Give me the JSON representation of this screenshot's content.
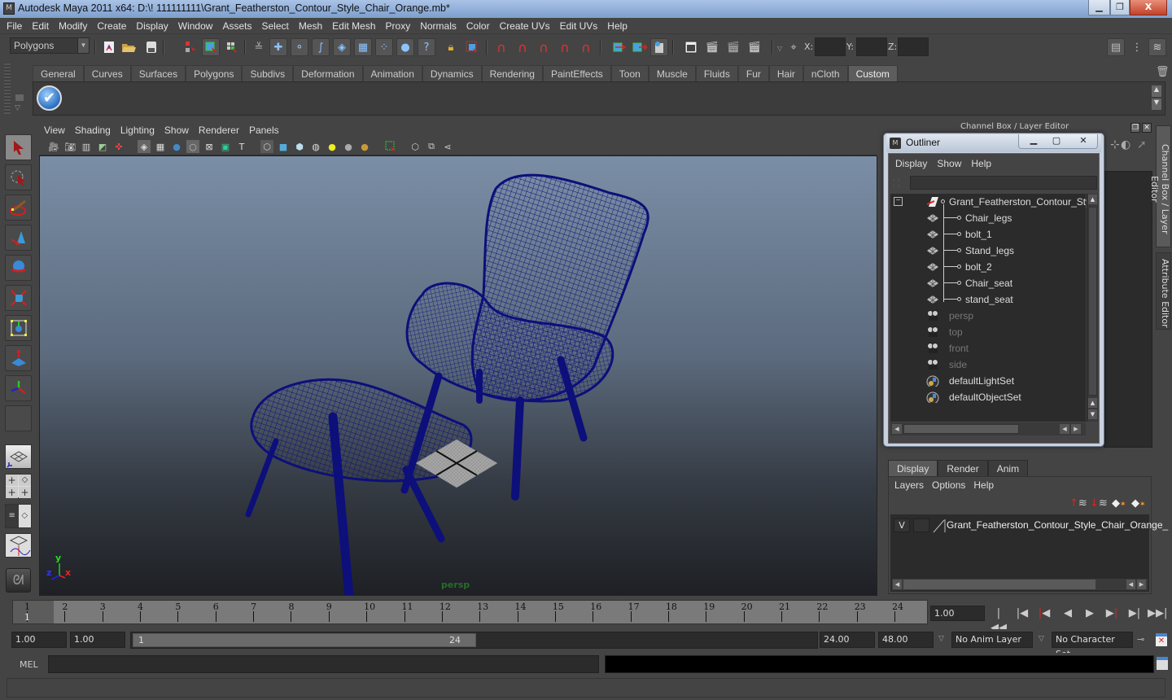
{
  "window": {
    "title": "Autodesk Maya 2011 x64: D:\\! 111111111\\Grant_Featherston_Contour_Style_Chair_Orange.mb*",
    "controls": {
      "minimize": "▁",
      "restore": "❐",
      "close": "X"
    }
  },
  "menubar": [
    "File",
    "Edit",
    "Modify",
    "Create",
    "Display",
    "Window",
    "Assets",
    "Select",
    "Mesh",
    "Edit Mesh",
    "Proxy",
    "Normals",
    "Color",
    "Create UVs",
    "Edit UVs",
    "Help"
  ],
  "statusline": {
    "mode_selector": "Polygons",
    "xyz_labels": {
      "x": "X:",
      "y": "Y:",
      "z": "Z:"
    },
    "icons": [
      "new-scene-icon",
      "open-scene-icon",
      "save-scene-icon",
      "select-by-hierarchy-icon",
      "select-by-object-icon",
      "select-by-component-icon",
      "snap-grid-icon",
      "snap-curve-icon",
      "snap-point-icon",
      "snap-view-plane-icon",
      "snap-live-icon",
      "render-icon",
      "ipr-render-icon",
      "render-settings-icon",
      "hypershade-icon"
    ]
  },
  "shelf": {
    "tabs": [
      "General",
      "Curves",
      "Surfaces",
      "Polygons",
      "Subdivs",
      "Deformation",
      "Animation",
      "Dynamics",
      "Rendering",
      "PaintEffects",
      "Toon",
      "Muscle",
      "Fluids",
      "Fur",
      "Hair",
      "nCloth",
      "Custom"
    ],
    "active_tab": "Custom"
  },
  "toolbox": {
    "tools": [
      "select-tool",
      "lasso-tool",
      "paint-select-tool",
      "move-tool",
      "rotate-tool",
      "scale-tool",
      "universal-manipulator",
      "soft-modification-tool",
      "show-manipulator-tool",
      "last-tool-slot"
    ],
    "layouts": [
      "single-perspective-layout",
      "four-view-layout",
      "outliner-persp-layout",
      "graph-editor-layout"
    ]
  },
  "viewport": {
    "panel_menu": [
      "View",
      "Shading",
      "Lighting",
      "Show",
      "Renderer",
      "Panels"
    ],
    "camera_label": "persp",
    "axis": {
      "x": "x",
      "y": "y",
      "z": "z"
    },
    "wire_color": "#0d0f7a"
  },
  "channel_box": {
    "title": "Channel Box / Layer Editor",
    "side_tabs": [
      "Channel Box / Layer Editor",
      "Attribute Editor"
    ]
  },
  "outliner": {
    "title": "Outliner",
    "menu": [
      "Display",
      "Show",
      "Help"
    ],
    "items": [
      {
        "label": "Grant_Featherston_Contour_Style",
        "type": "group",
        "dim": false
      },
      {
        "label": "Chair_legs",
        "type": "mesh",
        "dim": false
      },
      {
        "label": "bolt_1",
        "type": "mesh",
        "dim": false
      },
      {
        "label": "Stand_legs",
        "type": "mesh",
        "dim": false
      },
      {
        "label": "bolt_2",
        "type": "mesh",
        "dim": false
      },
      {
        "label": "Chair_seat",
        "type": "mesh",
        "dim": false
      },
      {
        "label": "stand_seat",
        "type": "mesh",
        "dim": false
      },
      {
        "label": "persp",
        "type": "camera",
        "dim": true
      },
      {
        "label": "top",
        "type": "camera",
        "dim": true
      },
      {
        "label": "front",
        "type": "camera",
        "dim": true
      },
      {
        "label": "side",
        "type": "camera",
        "dim": true
      },
      {
        "label": "defaultLightSet",
        "type": "set",
        "dim": false
      },
      {
        "label": "defaultObjectSet",
        "type": "set",
        "dim": false
      }
    ]
  },
  "layer_editor": {
    "tabs": [
      "Display",
      "Render",
      "Anim"
    ],
    "active_tab": "Display",
    "menu": [
      "Layers",
      "Options",
      "Help"
    ],
    "layers": [
      {
        "visible": "V",
        "name": "Grant_Featherston_Contour_Style_Chair_Orange_"
      }
    ]
  },
  "timeline": {
    "frames": [
      "1",
      "2",
      "3",
      "4",
      "5",
      "6",
      "7",
      "8",
      "9",
      "10",
      "11",
      "12",
      "13",
      "14",
      "15",
      "16",
      "17",
      "18",
      "19",
      "20",
      "21",
      "22",
      "23",
      "24"
    ],
    "current_frame_marker": "1",
    "current_time": "1.00",
    "playback_buttons": [
      "go-to-start",
      "step-back-frame",
      "step-back-key",
      "play-backwards",
      "play-forwards",
      "step-forward-key",
      "step-forward-frame",
      "go-to-end"
    ]
  },
  "range": {
    "start_time": "1.00",
    "playback_start": "1.00",
    "range_start": "1",
    "range_end": "24",
    "playback_end": "24.00",
    "end_time": "48.00",
    "anim_layer": "No Anim Layer",
    "character_set": "No Character Set"
  },
  "command_line": {
    "label": "MEL",
    "input": "",
    "result": ""
  }
}
